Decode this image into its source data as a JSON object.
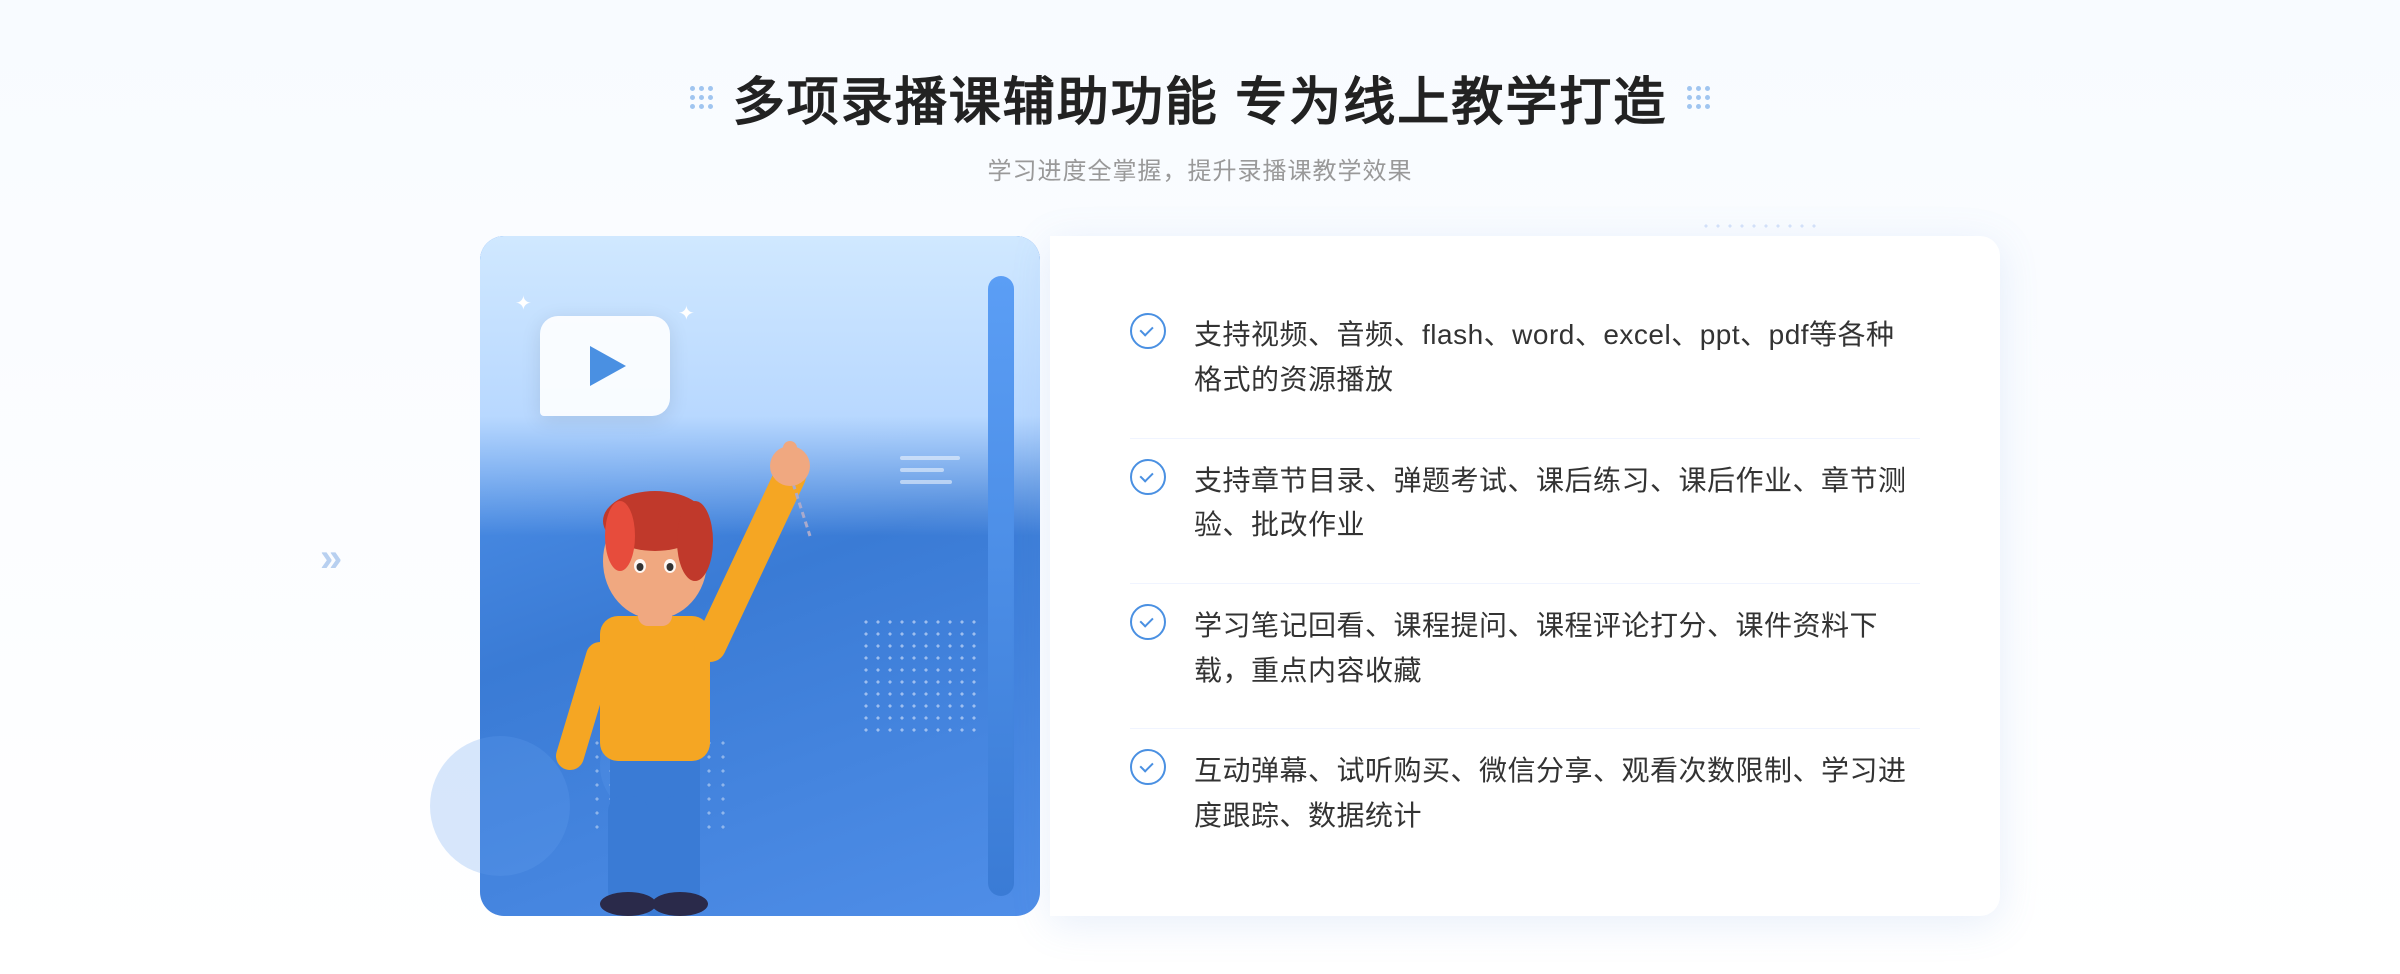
{
  "header": {
    "title": "多项录播课辅助功能 专为线上教学打造",
    "subtitle": "学习进度全掌握，提升录播课教学效果",
    "dots_icon_label": "decorative-dots"
  },
  "features": [
    {
      "id": "feature-1",
      "text": "支持视频、音频、flash、word、excel、ppt、pdf等各种格式的资源播放"
    },
    {
      "id": "feature-2",
      "text": "支持章节目录、弹题考试、课后练习、课后作业、章节测验、批改作业"
    },
    {
      "id": "feature-3",
      "text": "学习笔记回看、课程提问、课程评论打分、课件资料下载，重点内容收藏"
    },
    {
      "id": "feature-4",
      "text": "互动弹幕、试听购买、微信分享、观看次数限制、学习进度跟踪、数据统计"
    }
  ],
  "colors": {
    "accent_blue": "#4a90e2",
    "title_color": "#222222",
    "subtitle_color": "#999999",
    "text_color": "#333333",
    "panel_bg": "#ffffff"
  },
  "decorative": {
    "chevron_symbol": "»",
    "sparkle_symbol": "✦",
    "play_label": "play-button"
  }
}
